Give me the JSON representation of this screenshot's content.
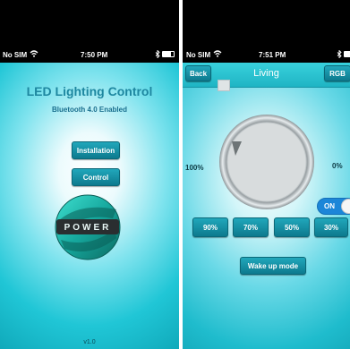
{
  "left_screen": {
    "status": {
      "carrier": "No SIM",
      "time": "7:50 PM"
    },
    "title": "LED Lighting Control",
    "subtitle": "Bluetooth 4.0 Enabled",
    "installation_button": "Installation",
    "control_button": "Control",
    "logo_text": "POWER",
    "version": "v1.0"
  },
  "right_screen": {
    "status": {
      "carrier": "No SIM",
      "time": "7:51 PM"
    },
    "nav": {
      "back": "Back",
      "title": "Living",
      "rgb": "RGB"
    },
    "dial": {
      "max_label": "100%",
      "min_label": "0%"
    },
    "toggle": {
      "label": "ON",
      "state": true
    },
    "presets": [
      "90%",
      "70%",
      "50%",
      "30%"
    ],
    "wake_button": "Wake up mode"
  },
  "colors": {
    "accent": "#1fb4c4",
    "button": "#0d7a8e",
    "title": "#1e87a0"
  }
}
